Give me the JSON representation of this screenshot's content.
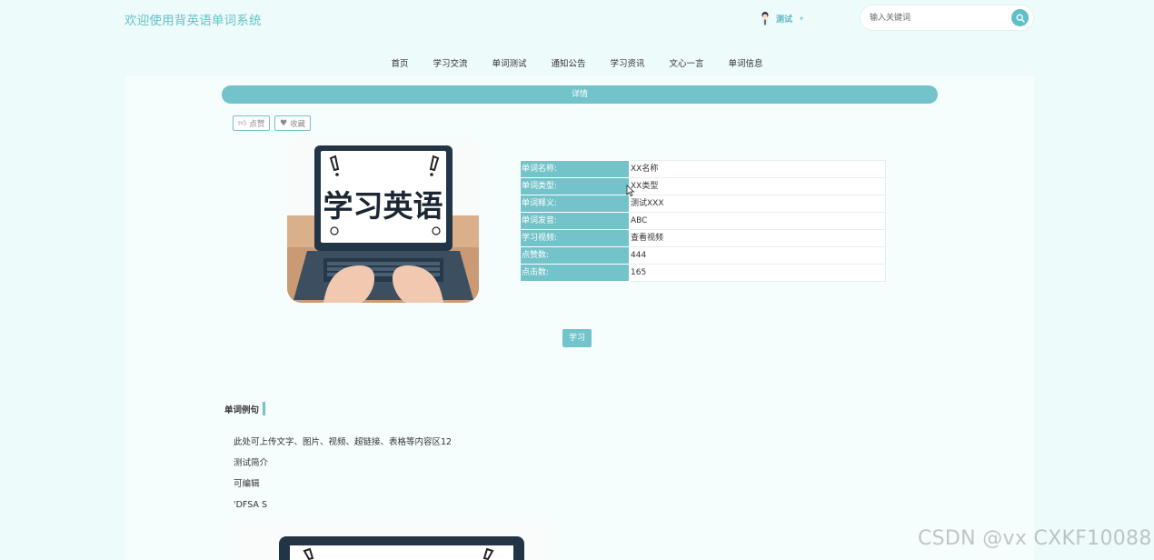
{
  "header": {
    "site_title": "欢迎使用背英语单词系统",
    "user_name": "测试",
    "search_placeholder": "输入关键词"
  },
  "nav": {
    "items": [
      "首页",
      "学习交流",
      "单词测试",
      "通知公告",
      "学习资讯",
      "文心一言",
      "单词信息"
    ]
  },
  "detail": {
    "bar_label": "详情",
    "like_label": "点赞",
    "favorite_label": "收藏",
    "image_text": "学习英语",
    "fields": [
      {
        "label": "单词名称:",
        "value": "XX名称"
      },
      {
        "label": "单词类型:",
        "value": "XX类型"
      },
      {
        "label": "单词释义:",
        "value": "测试XXX"
      },
      {
        "label": "单词发音:",
        "value": "ABC"
      },
      {
        "label": "学习视频:",
        "value": "查看视频"
      },
      {
        "label": "点赞数:",
        "value": "444"
      },
      {
        "label": "点击数:",
        "value": "165"
      }
    ],
    "study_button": "学习"
  },
  "example": {
    "title": "单词例句",
    "lines": [
      "此处可上传文字、图片、视频、超链接、表格等内容区12",
      "测试简介",
      "可编辑",
      "'DFSA S"
    ]
  },
  "watermark": "CSDN @vx  CXKF10088",
  "colors": {
    "accent": "#72c3ca",
    "title": "#63c2c8",
    "background": "#eefbfb"
  }
}
